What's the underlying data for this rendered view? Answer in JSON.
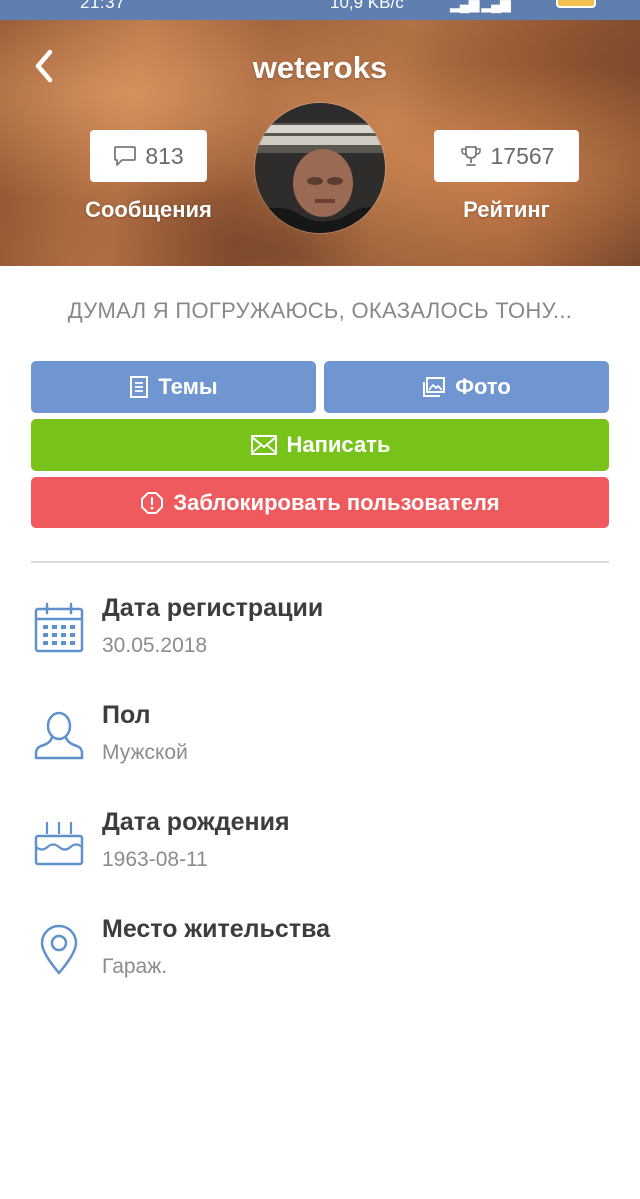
{
  "status_bar": {
    "time": "21:37",
    "network_speed": "10,9 KB/c",
    "battery_level": "82"
  },
  "header": {
    "username": "weteroks",
    "messages_count": "813",
    "messages_label": "Сообщения",
    "rating_value": "17567",
    "rating_label": "Рейтинг"
  },
  "profile": {
    "status_text": "ДУМАЛ Я ПОГРУЖАЮСЬ, ОКАЗАЛОСЬ ТОНУ..."
  },
  "actions": {
    "topics_label": "Темы",
    "photo_label": "Фото",
    "write_label": "Написать",
    "block_label": "Заблокировать пользователя"
  },
  "info": {
    "registration_title": "Дата регистрации",
    "registration_value": "30.05.2018",
    "gender_title": "Пол",
    "gender_value": "Мужской",
    "birthday_title": "Дата рождения",
    "birthday_value": "1963-08-11",
    "location_title": "Место жительства",
    "location_value": "Гараж."
  },
  "colors": {
    "accent_blue": "#6f96d1",
    "write_green": "#78c31a",
    "block_red": "#ee5a5d",
    "icon_blue": "#5f91cc"
  },
  "icons": {
    "back": "chevron-left-icon",
    "messages": "chat-bubble-icon",
    "rating": "trophy-icon",
    "topics": "document-icon",
    "photo": "image-icon",
    "write": "envelope-icon",
    "block": "alert-octagon-icon",
    "registration": "calendar-icon",
    "gender": "user-icon",
    "birthday": "cake-icon",
    "location": "map-pin-icon"
  }
}
